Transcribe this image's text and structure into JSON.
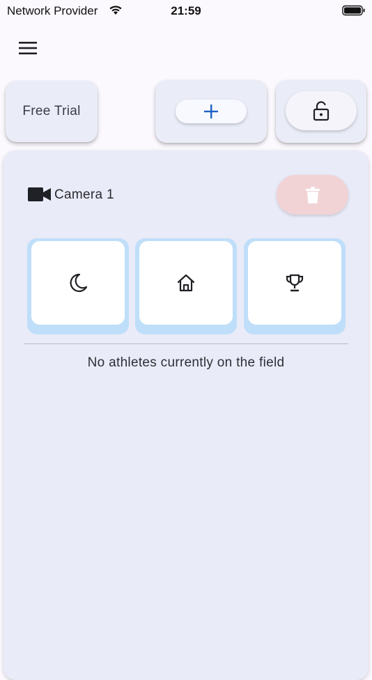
{
  "status_bar": {
    "carrier": "Network Provider",
    "time": "21:59",
    "wifi_icon": "wifi-icon",
    "battery_icon": "battery-full-icon"
  },
  "app_bar": {
    "menu_icon": "hamburger-menu-icon"
  },
  "toolbar": {
    "free_trial_label": "Free Trial",
    "add_icon": "plus-icon",
    "lock_icon": "lock-open-icon"
  },
  "camera": {
    "icon": "videocam-icon",
    "title": "Camera 1",
    "delete_icon": "trash-icon",
    "modes": [
      {
        "name": "night",
        "icon": "moon-icon"
      },
      {
        "name": "home",
        "icon": "home-icon"
      },
      {
        "name": "trophy",
        "icon": "trophy-icon"
      }
    ],
    "empty_message": "No athletes currently on the field"
  },
  "colors": {
    "accent": "#1d5fc4",
    "tile_border": "#bfdef9",
    "panel_bg": "#e9ebf8",
    "delete_bg": "#f1d3d6"
  }
}
